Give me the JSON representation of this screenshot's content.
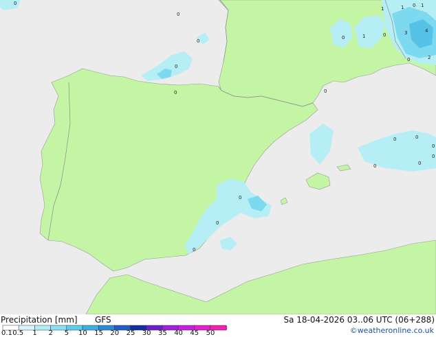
{
  "map": {
    "colors": {
      "sea": "#ececec",
      "land": "#c3f5a5",
      "precip_light": "#b6eef6",
      "precip_medium": "#7dd9ef",
      "precip_heavy": "#56c2e6",
      "border": "#8a8a8a",
      "coast": "#999999"
    },
    "value_labels": [
      "0",
      "0",
      "0",
      "0",
      "0",
      "0",
      "0",
      "0",
      "0",
      "0",
      "0",
      "0",
      "0",
      "0",
      "0",
      "0",
      "0",
      "0",
      "0",
      "1",
      "1",
      "1",
      "1",
      "3",
      "4",
      "2"
    ]
  },
  "legend": {
    "title": "Precipitation [mm]",
    "model": "GFS",
    "datetime": "Sa 18-04-2026 03..06 UTC (06+288)",
    "ticks": [
      "0.1",
      "0.5",
      "1",
      "2",
      "5",
      "10",
      "15",
      "20",
      "25",
      "30",
      "35",
      "40",
      "45",
      "50"
    ],
    "colors": [
      "#ffffff",
      "#d6f5fc",
      "#b2ecf8",
      "#8ae0f5",
      "#5acdf0",
      "#3caee6",
      "#2b8ad7",
      "#1f5fc3",
      "#12309f",
      "#6a21c9",
      "#a01fd9",
      "#c81fe0",
      "#e31fcf",
      "#f21fb2"
    ],
    "credit": "©weatheronline.co.uk"
  }
}
